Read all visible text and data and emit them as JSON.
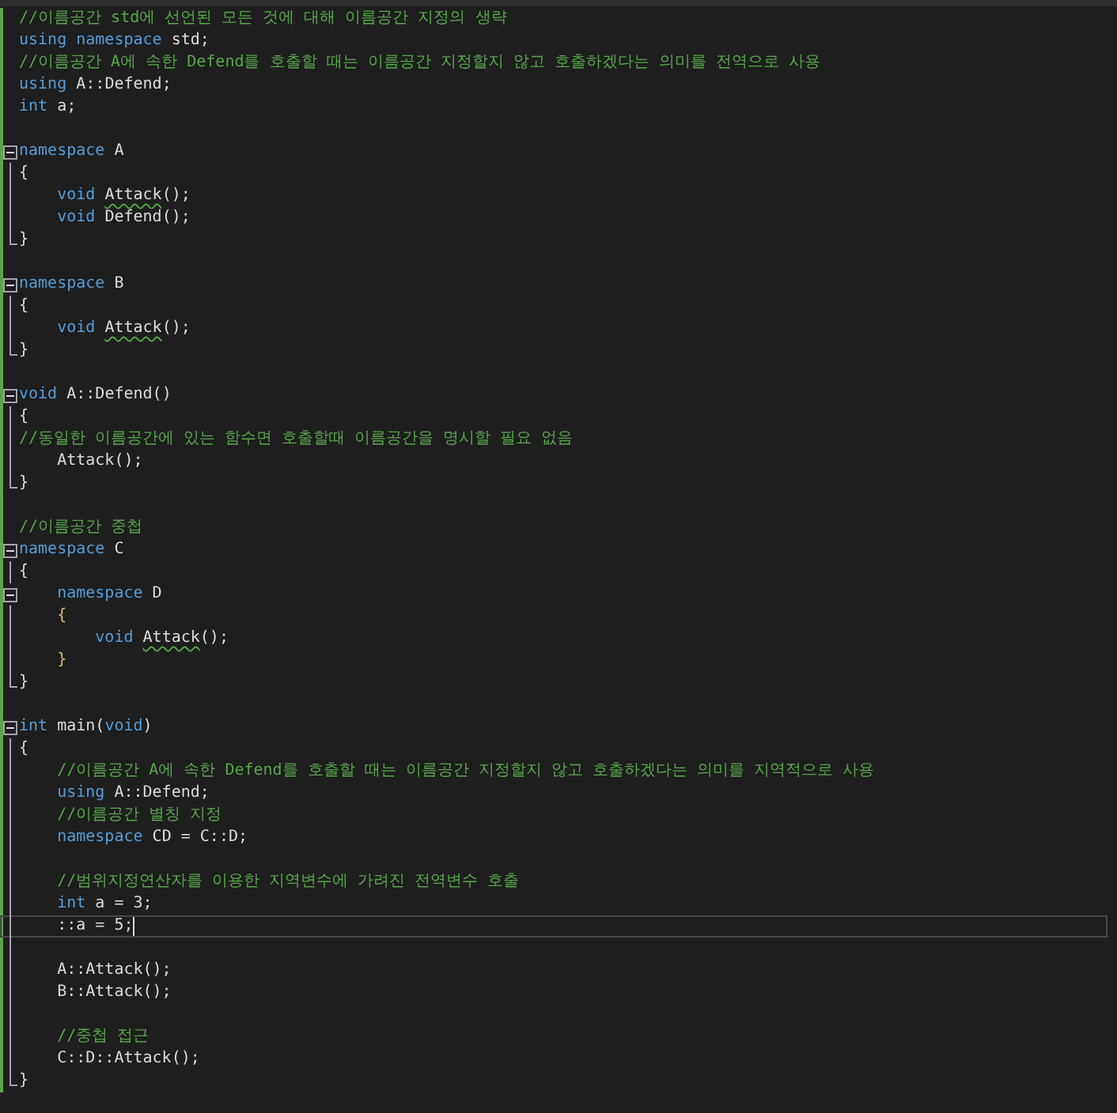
{
  "editor": {
    "lines": [
      {
        "kind": "none",
        "tokens": [
          {
            "kind": "comment",
            "text": "//이름공간 std에 선언된 모든 것에 대해 이름공간 지정의 생략"
          }
        ]
      },
      {
        "kind": "none",
        "tokens": [
          {
            "kind": "keyword",
            "text": "using namespace"
          },
          {
            "kind": "plain",
            "text": " std;"
          }
        ]
      },
      {
        "kind": "none",
        "tokens": [
          {
            "kind": "comment",
            "text": "//이름공간 A에 속한 Defend를 호출할 때는 이름공간 지정할지 않고 호출하겠다는 의미를 전역으로 사용"
          }
        ]
      },
      {
        "kind": "none",
        "tokens": [
          {
            "kind": "keyword",
            "text": "using"
          },
          {
            "kind": "plain",
            "text": " A::Defend;"
          }
        ]
      },
      {
        "kind": "none",
        "tokens": [
          {
            "kind": "keyword",
            "text": "int"
          },
          {
            "kind": "plain",
            "text": " a;"
          }
        ]
      },
      {
        "kind": "none"
      },
      {
        "kind": "fold",
        "expanded": true,
        "tokens": [
          {
            "kind": "keyword",
            "text": "namespace"
          },
          {
            "kind": "plain",
            "text": " A"
          }
        ]
      },
      {
        "kind": "bar",
        "tokens": [
          {
            "kind": "plain",
            "text": "{"
          }
        ]
      },
      {
        "kind": "bar",
        "tokens": [
          {
            "kind": "keyword",
            "text": "    void "
          },
          {
            "kind": "plain",
            "text": "Attack",
            "warn": true
          },
          {
            "kind": "plain",
            "text": "();"
          }
        ]
      },
      {
        "kind": "bar",
        "tokens": [
          {
            "kind": "keyword",
            "text": "    void"
          },
          {
            "kind": "plain",
            "text": " Defend();"
          }
        ]
      },
      {
        "kind": "end",
        "tokens": [
          {
            "kind": "plain",
            "text": "}"
          }
        ]
      },
      {
        "kind": "none"
      },
      {
        "kind": "fold",
        "expanded": true,
        "tokens": [
          {
            "kind": "keyword",
            "text": "namespace"
          },
          {
            "kind": "plain",
            "text": " B"
          }
        ]
      },
      {
        "kind": "bar",
        "tokens": [
          {
            "kind": "plain",
            "text": "{"
          }
        ]
      },
      {
        "kind": "bar",
        "tokens": [
          {
            "kind": "keyword",
            "text": "    void "
          },
          {
            "kind": "plain",
            "text": "Attack",
            "warn": true
          },
          {
            "kind": "plain",
            "text": "();"
          }
        ]
      },
      {
        "kind": "end",
        "tokens": [
          {
            "kind": "plain",
            "text": "}"
          }
        ]
      },
      {
        "kind": "none"
      },
      {
        "kind": "fold",
        "expanded": true,
        "tokens": [
          {
            "kind": "keyword",
            "text": "void"
          },
          {
            "kind": "plain",
            "text": " A::Defend()"
          }
        ]
      },
      {
        "kind": "bar",
        "tokens": [
          {
            "kind": "plain",
            "text": "{"
          }
        ]
      },
      {
        "kind": "bar",
        "tokens": [
          {
            "kind": "comment",
            "text": "//동일한 이름공간에 있는 함수면 호출할때 이름공간을 명시할 필요 없음"
          }
        ]
      },
      {
        "kind": "bar",
        "tokens": [
          {
            "kind": "plain",
            "text": "    Attack();"
          }
        ]
      },
      {
        "kind": "end",
        "tokens": [
          {
            "kind": "plain",
            "text": "}"
          }
        ]
      },
      {
        "kind": "none"
      },
      {
        "kind": "none",
        "tokens": [
          {
            "kind": "comment",
            "text": "//이름공간 중첩"
          }
        ]
      },
      {
        "kind": "fold",
        "expanded": true,
        "tokens": [
          {
            "kind": "keyword",
            "text": "namespace"
          },
          {
            "kind": "plain",
            "text": " C"
          }
        ]
      },
      {
        "kind": "bar",
        "tokens": [
          {
            "kind": "plain",
            "text": "{"
          }
        ]
      },
      {
        "kind": "fold",
        "expanded": true,
        "tokens": [
          {
            "kind": "keyword",
            "text": "    namespace"
          },
          {
            "kind": "plain",
            "text": " D"
          }
        ]
      },
      {
        "kind": "bar",
        "tokens": [
          {
            "kind": "bracket",
            "text": "    {"
          }
        ]
      },
      {
        "kind": "bar",
        "tokens": [
          {
            "kind": "keyword",
            "text": "        void "
          },
          {
            "kind": "plain",
            "text": "Attack",
            "warn": true
          },
          {
            "kind": "plain",
            "text": "();"
          }
        ]
      },
      {
        "kind": "bar",
        "tokens": [
          {
            "kind": "bracket",
            "text": "    }"
          }
        ]
      },
      {
        "kind": "end",
        "tokens": [
          {
            "kind": "plain",
            "text": "}"
          }
        ]
      },
      {
        "kind": "none"
      },
      {
        "kind": "fold",
        "expanded": true,
        "tokens": [
          {
            "kind": "keyword",
            "text": "int"
          },
          {
            "kind": "plain",
            "text": " main("
          },
          {
            "kind": "keyword",
            "text": "void"
          },
          {
            "kind": "plain",
            "text": ")"
          }
        ]
      },
      {
        "kind": "bar",
        "tokens": [
          {
            "kind": "plain",
            "text": "{"
          }
        ]
      },
      {
        "kind": "bar",
        "tokens": [
          {
            "kind": "comment",
            "text": "    //이름공간 A에 속한 Defend를 호출할 때는 이름공간 지정할지 않고 호출하겠다는 의미를 지역적으로 사용"
          }
        ]
      },
      {
        "kind": "bar",
        "tokens": [
          {
            "kind": "keyword",
            "text": "    using"
          },
          {
            "kind": "plain",
            "text": " A::Defend;"
          }
        ]
      },
      {
        "kind": "bar",
        "tokens": [
          {
            "kind": "comment",
            "text": "    //이름공간 별칭 지정"
          }
        ]
      },
      {
        "kind": "bar",
        "tokens": [
          {
            "kind": "keyword",
            "text": "    namespace"
          },
          {
            "kind": "plain",
            "text": " CD = C::D;"
          }
        ]
      },
      {
        "kind": "bar"
      },
      {
        "kind": "bar",
        "tokens": [
          {
            "kind": "comment",
            "text": "    //범위지정연산자를 이용한 지역변수에 가려진 전역변수 호출"
          }
        ]
      },
      {
        "kind": "bar",
        "tokens": [
          {
            "kind": "keyword",
            "text": "    int"
          },
          {
            "kind": "plain",
            "text": " a = 3;"
          }
        ]
      },
      {
        "kind": "bar",
        "current": true,
        "tokens": [
          {
            "kind": "plain",
            "text": "    ::a = 5;"
          }
        ]
      },
      {
        "kind": "bar"
      },
      {
        "kind": "bar",
        "tokens": [
          {
            "kind": "plain",
            "text": "    A::Attack();"
          }
        ]
      },
      {
        "kind": "bar",
        "tokens": [
          {
            "kind": "plain",
            "text": "    B::Attack();"
          }
        ]
      },
      {
        "kind": "bar"
      },
      {
        "kind": "bar",
        "tokens": [
          {
            "kind": "comment",
            "text": "    //중첩 접근"
          }
        ]
      },
      {
        "kind": "bar",
        "tokens": [
          {
            "kind": "plain",
            "text": "    C::D::Attack();"
          }
        ]
      },
      {
        "kind": "end",
        "tokens": [
          {
            "kind": "plain",
            "text": "}"
          }
        ]
      }
    ]
  }
}
